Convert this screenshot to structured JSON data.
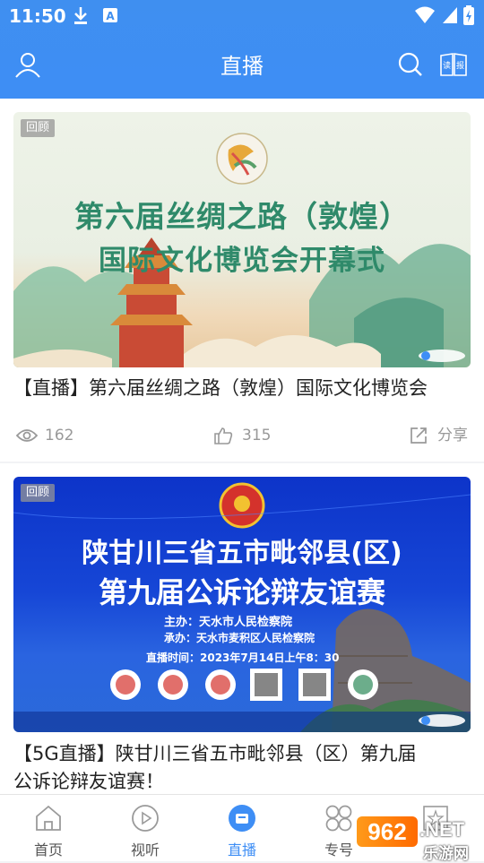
{
  "status_bar": {
    "time": "11:50"
  },
  "header": {
    "title": "直播",
    "read_label": "读报"
  },
  "cards": [
    {
      "tag": "回顾",
      "poster_line1": "第六届丝绸之路（敦煌）",
      "poster_line2": "国际文化博览会开幕式",
      "title": "【直播】第六届丝绸之路（敦煌）国际文化博览会",
      "views": "162",
      "likes": "315",
      "share": "分享"
    },
    {
      "tag": "回顾",
      "poster_line1": "陕甘川三省五市毗邻县(区)",
      "poster_line2": "第九届公诉论辩友谊赛",
      "poster_host": "主办：天水市人民检察院",
      "poster_cohost": "承办：天水市麦积区人民检察院",
      "poster_time": "直播时间：2023年7月14日上午8：30",
      "title_line1": "【5G直播】陕甘川三省五市毗邻县（区）第九届",
      "title_line2": "公诉论辩友谊赛！"
    }
  ],
  "tabbar": {
    "items": [
      {
        "label": "首页",
        "icon": "home-icon"
      },
      {
        "label": "视听",
        "icon": "play-icon"
      },
      {
        "label": "直播",
        "icon": "live-icon",
        "active": true
      },
      {
        "label": "专号",
        "icon": "grid-icon"
      },
      {
        "label": "",
        "icon": "star-icon"
      }
    ]
  },
  "watermark": {
    "number": "962",
    "domain": ".NET",
    "site": "乐游网"
  },
  "colors": {
    "accent": "#3e8ef5",
    "tag_bg": "#969696",
    "text": "#222222",
    "muted": "#999999"
  }
}
